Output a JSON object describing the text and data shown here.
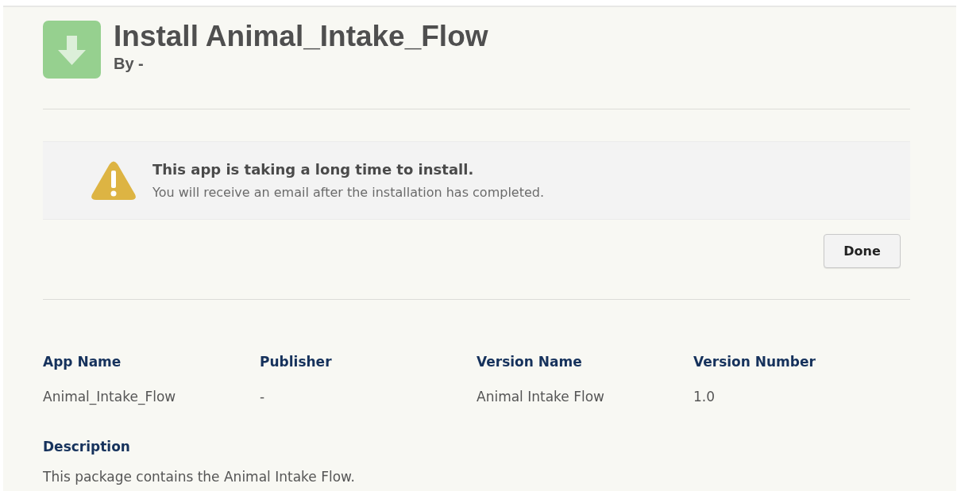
{
  "header": {
    "title": "Install Animal_Intake_Flow",
    "byline": "By -"
  },
  "alert": {
    "title": "This app is taking a long time to install.",
    "message": "You will receive an email after the installation has completed."
  },
  "buttons": [
    "Done"
  ],
  "details": [
    {
      "label": "App Name",
      "value": "Animal_Intake_Flow"
    },
    {
      "label": "Publisher",
      "value": "-"
    },
    {
      "label": "Version Name",
      "value": "Animal Intake Flow"
    },
    {
      "label": "Version Number",
      "value": "1.0"
    }
  ],
  "description": {
    "label": "Description",
    "text": "This package contains the Animal Intake Flow."
  }
}
